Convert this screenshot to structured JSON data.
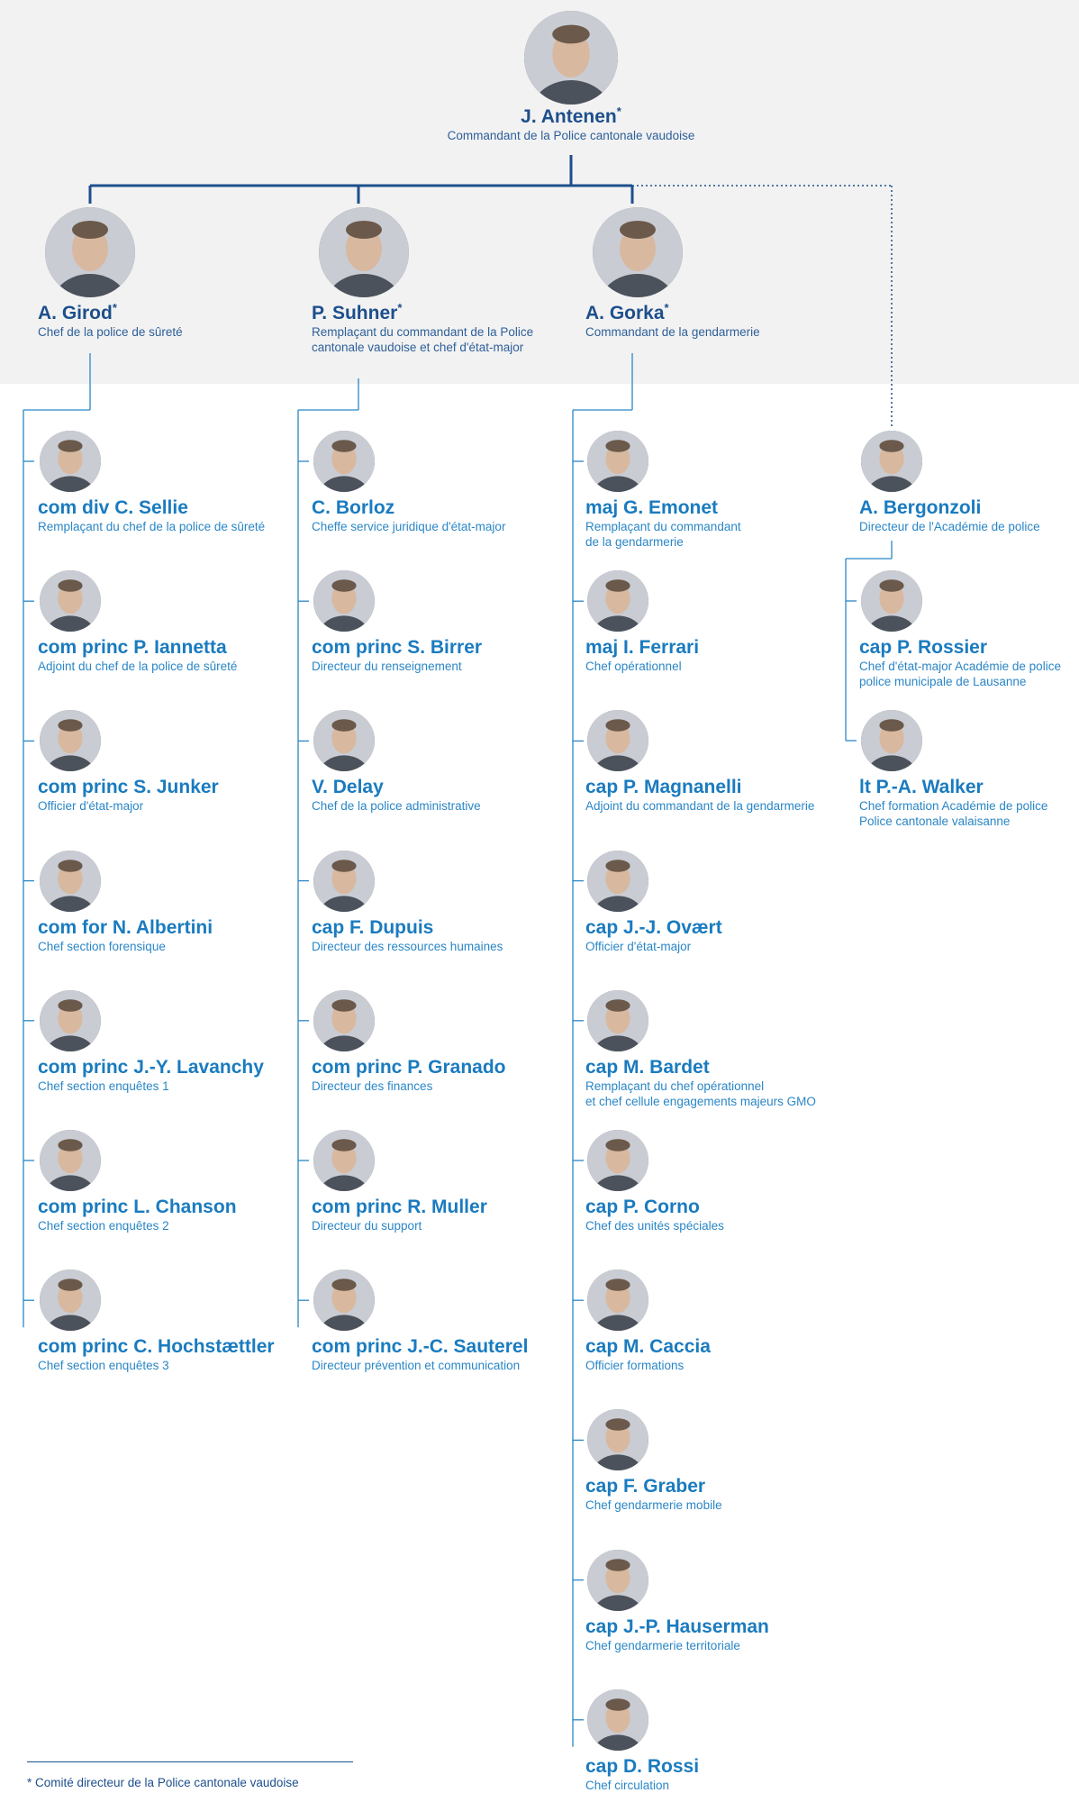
{
  "top": {
    "name": "J. Antenen",
    "starred": true,
    "role": "Commandant de la Police cantonale vaudoise"
  },
  "directors": [
    {
      "name": "A. Girod",
      "starred": true,
      "role": "Chef de la police de sûreté"
    },
    {
      "name": "P. Suhner",
      "starred": true,
      "role": "Remplaçant du commandant de la Police\ncantonale vaudoise et chef d'état-major"
    },
    {
      "name": "A. Gorka",
      "starred": true,
      "role": "Commandant de la gendarmerie"
    }
  ],
  "columns": [
    [
      {
        "name": "com div C. Sellie",
        "role": "Remplaçant du chef de la police de sûreté"
      },
      {
        "name": "com princ P. Iannetta",
        "role": "Adjoint du chef de la police de sûreté"
      },
      {
        "name": "com princ S. Junker",
        "role": "Officier d'état-major"
      },
      {
        "name": "com for N. Albertini",
        "role": "Chef section forensique"
      },
      {
        "name": "com princ J.-Y. Lavanchy",
        "role": "Chef section enquêtes 1"
      },
      {
        "name": "com princ L. Chanson",
        "role": "Chef section enquêtes 2"
      },
      {
        "name": "com princ C. Hochstættler",
        "role": "Chef section enquêtes 3"
      }
    ],
    [
      {
        "name": "C. Borloz",
        "role": "Cheffe service juridique d'état-major"
      },
      {
        "name": "com princ S. Birrer",
        "role": "Directeur du renseignement"
      },
      {
        "name": "V. Delay",
        "role": "Chef de la police administrative"
      },
      {
        "name": "cap F. Dupuis",
        "role": "Directeur des ressources humaines"
      },
      {
        "name": "com princ P. Granado",
        "role": "Directeur des finances"
      },
      {
        "name": "com princ R. Muller",
        "role": "Directeur du support"
      },
      {
        "name": "com princ J.-C. Sauterel",
        "role": "Directeur prévention et communication"
      }
    ],
    [
      {
        "name": "maj G. Emonet",
        "role": "Remplaçant du commandant\nde la gendarmerie"
      },
      {
        "name": "maj I. Ferrari",
        "role": "Chef opérationnel"
      },
      {
        "name": "cap P. Magnanelli",
        "role": "Adjoint du commandant de la gendarmerie"
      },
      {
        "name": "cap J.-J. Ovært",
        "role": "Officier d'état-major"
      },
      {
        "name": "cap M. Bardet",
        "role": "Remplaçant du chef opérationnel\net chef cellule engagements majeurs GMO"
      },
      {
        "name": "cap P. Corno",
        "role": "Chef des unités spéciales"
      },
      {
        "name": "cap M. Caccia",
        "role": "Officier formations"
      },
      {
        "name": "cap F. Graber",
        "role": "Chef gendarmerie mobile"
      },
      {
        "name": "cap J.-P. Hauserman",
        "role": "Chef gendarmerie territoriale"
      },
      {
        "name": "cap D. Rossi",
        "role": "Chef circulation"
      }
    ]
  ],
  "academy": {
    "head": {
      "name": "A. Bergonzoli",
      "role": "Directeur de l'Académie de police"
    },
    "staff": [
      {
        "name": "cap P. Rossier",
        "role": "Chef d'état-major Académie de police\npolice municipale de Lausanne"
      },
      {
        "name": "lt P.-A. Walker",
        "role": "Chef formation Académie de police\nPolice cantonale valaisanne"
      }
    ]
  },
  "footnote": "*  Comité directeur de la Police cantonale vaudoise"
}
